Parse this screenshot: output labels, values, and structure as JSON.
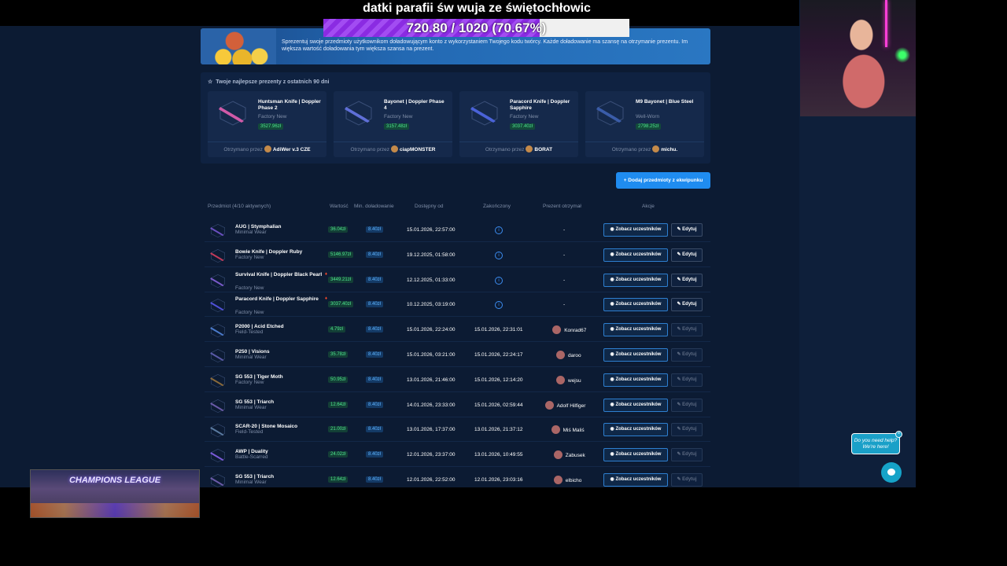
{
  "overlay": {
    "title": "datki parafii św wuja ze świętochłowic",
    "progress_text": "720.80 / 1020 (70.67%)",
    "progress_fraction": 0.7067,
    "champions_text": "CHAMPIONS LEAGUE"
  },
  "banner": {
    "text": "Sprezentuj swoje przedmioty użytkownikom doładowującym konto z wykorzystaniem Twojego kodu twórcy. Każde doładowanie ma szansę na otrzymanie prezentu. Im większa wartość doładowania tym większa szansa na prezent."
  },
  "top_gifts": {
    "title": "Twoje najlepsze prezenty z ostatnich 90 dni",
    "received_by_label": "Otrzymano przez",
    "items": [
      {
        "name": "Huntsman Knife | Doppler Phase 2",
        "condition": "Factory New",
        "value": "3527.96zł",
        "receiver": "AdiWer v.3 CZE"
      },
      {
        "name": "Bayonet | Doppler Phase 4",
        "condition": "Factory New",
        "value": "3157.48zł",
        "receiver": "ciapMONSTER"
      },
      {
        "name": "Paracord Knife | Doppler Sapphire",
        "condition": "Factory New",
        "value": "3037.40zł",
        "receiver": "BORAT"
      },
      {
        "name": "M9 Bayonet | Blue Steel",
        "condition": "Well-Worn",
        "value": "2798.25zł",
        "receiver": "michu."
      }
    ]
  },
  "add_button": "+ Dodaj przedmioty z ekwipunku",
  "table": {
    "headers": {
      "item": "Przedmiot (4/10 aktywnych)",
      "value": "Wartość",
      "min": "Min. doładowanie",
      "from": "Dostępny od",
      "to": "Zakończony",
      "winner": "Prezent otrzymał",
      "actions": "Akcje"
    },
    "view_label": "Zobacz uczestników",
    "edit_label": "Edytuj",
    "rows": [
      {
        "name": "AUG | Stymphalian",
        "condition": "Minimal Wear",
        "value": "36.04zł",
        "min": "8.40zł",
        "from": "15.01.2026, 22:57:00",
        "to": "",
        "winner": "-",
        "active": true,
        "hot": false
      },
      {
        "name": "Bowie Knife | Doppler Ruby",
        "condition": "Factory New",
        "value": "5146.97zł",
        "min": "8.40zł",
        "from": "19.12.2025, 01:58:00",
        "to": "",
        "winner": "-",
        "active": true,
        "hot": false
      },
      {
        "name": "Survival Knife | Doppler Black Pearl",
        "condition": "Factory New",
        "value": "3449.21zł",
        "min": "8.40zł",
        "from": "12.12.2025, 01:33:00",
        "to": "",
        "winner": "-",
        "active": true,
        "hot": true
      },
      {
        "name": "Paracord Knife | Doppler Sapphire",
        "condition": "Factory New",
        "value": "3037.40zł",
        "min": "8.40zł",
        "from": "10.12.2025, 03:19:00",
        "to": "",
        "winner": "-",
        "active": true,
        "hot": true
      },
      {
        "name": "P2000 | Acid Etched",
        "condition": "Field-Tested",
        "value": "4.79zł",
        "min": "8.40zł",
        "from": "15.01.2026, 22:24:00",
        "to": "15.01.2026, 22:31:01",
        "winner": "Konrad67",
        "active": false,
        "hot": false
      },
      {
        "name": "P250 | Visions",
        "condition": "Minimal Wear",
        "value": "35.78zł",
        "min": "8.40zł",
        "from": "15.01.2026, 03:21:00",
        "to": "15.01.2026, 22:24:17",
        "winner": "daroo",
        "active": false,
        "hot": false
      },
      {
        "name": "SG 553 | Tiger Moth",
        "condition": "Factory New",
        "value": "50.95zł",
        "min": "8.40zł",
        "from": "13.01.2026, 21:46:00",
        "to": "15.01.2026, 12:14:20",
        "winner": "wejsu",
        "active": false,
        "hot": false
      },
      {
        "name": "SG 553 | Triarch",
        "condition": "Minimal Wear",
        "value": "12.64zł",
        "min": "8.40zł",
        "from": "14.01.2026, 23:33:00",
        "to": "15.01.2026, 02:59:44",
        "winner": "Adolf Hilfiger",
        "active": false,
        "hot": false
      },
      {
        "name": "SCAR-20 | Stone Mosaico",
        "condition": "Field-Tested",
        "value": "21.00zł",
        "min": "8.40zł",
        "from": "13.01.2026, 17:37:00",
        "to": "13.01.2026, 21:37:12",
        "winner": "Miś Maliś",
        "active": false,
        "hot": false
      },
      {
        "name": "AWP | Duality",
        "condition": "Battle-Scarred",
        "value": "24.02zł",
        "min": "8.40zł",
        "from": "12.01.2026, 23:37:00",
        "to": "13.01.2026, 10:49:55",
        "winner": "Zabusek",
        "active": false,
        "hot": false
      },
      {
        "name": "SG 553 | Triarch",
        "condition": "Minimal Wear",
        "value": "12.64zł",
        "min": "8.40zł",
        "from": "12.01.2026, 22:52:00",
        "to": "12.01.2026, 23:03:16",
        "winner": "elbicho",
        "active": false,
        "hot": false
      }
    ]
  },
  "help": {
    "bubble": "Do you need help? We're here!",
    "close": "×"
  }
}
